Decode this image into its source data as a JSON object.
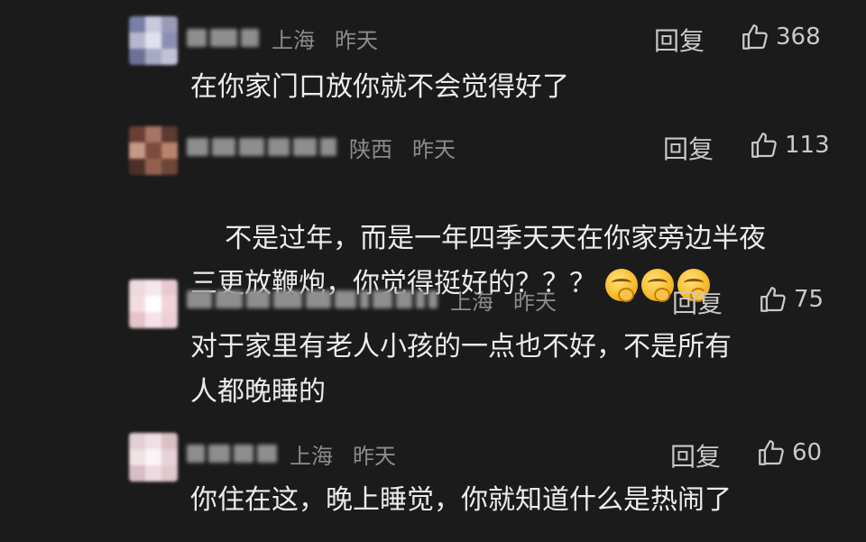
{
  "comments": [
    {
      "region": "上海",
      "time": "昨天",
      "reply_label": "回复",
      "likes": "368",
      "text": "在你家门口放你就不会觉得好了"
    },
    {
      "region": "陕西",
      "time": "昨天",
      "reply_label": "回复",
      "likes": "113",
      "text": "不是过年，而是一年四季天天在你家旁边半夜\n三更放鞭炮，你觉得挺好的？？？",
      "emoji": [
        "thinking-yawn-emoji",
        "thinking-yawn-emoji",
        "thinking-yawn-emoji"
      ]
    },
    {
      "region": "上海",
      "time": "昨天",
      "reply_label": "回复",
      "likes": "75",
      "text": "对于家里有老人小孩的一点也不好，不是所有\n人都晚睡的"
    },
    {
      "region": "上海",
      "time": "昨天",
      "reply_label": "回复",
      "likes": "60",
      "text": "你住在这，晚上睡觉，你就知道什么是热闹了"
    }
  ],
  "icons": {
    "like": "thumbs-up-outline-icon"
  },
  "colors": {
    "background": "#1b1b1b",
    "text": "#ececec",
    "meta": "#8c8c8c"
  }
}
